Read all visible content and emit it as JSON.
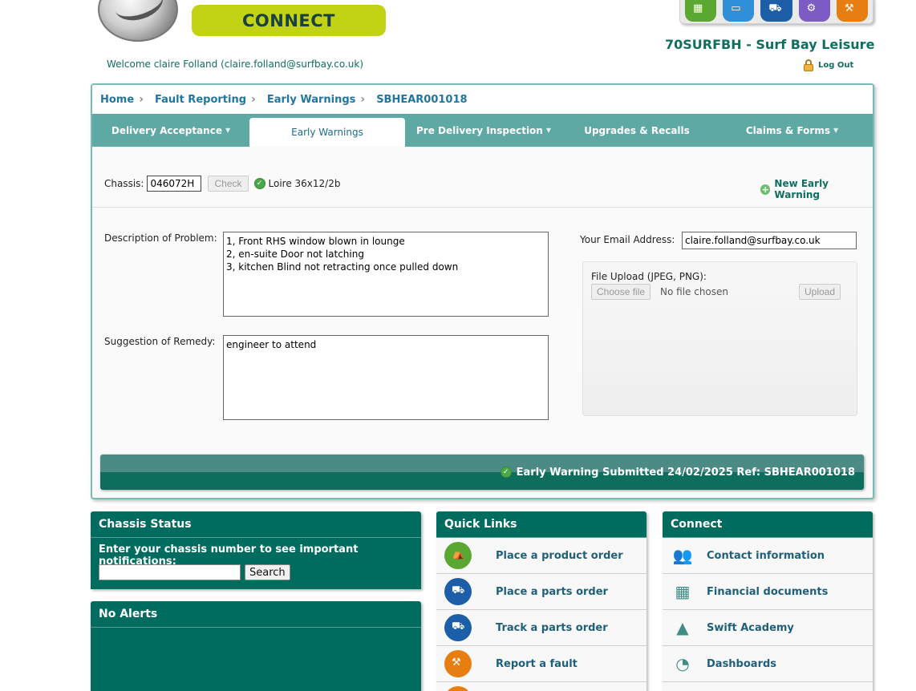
{
  "header": {
    "connect_label": "CONNECT",
    "company": "70SURFBH - Surf Bay Leisure",
    "welcome": "Welcome claire Folland (claire.folland@surfbay.co.uk)",
    "logout": "Log Out"
  },
  "breadcrumb": [
    {
      "label": "Home"
    },
    {
      "label": "Fault Reporting"
    },
    {
      "label": "Early Warnings"
    },
    {
      "label": "SBHEAR001018"
    }
  ],
  "tabs": [
    {
      "label": "Delivery Acceptance",
      "dropdown": true
    },
    {
      "label": "Early Warnings",
      "dropdown": false,
      "active": true
    },
    {
      "label": "Pre Delivery Inspection",
      "dropdown": true
    },
    {
      "label": "Upgrades & Recalls",
      "dropdown": false
    },
    {
      "label": "Claims & Forms",
      "dropdown": true
    }
  ],
  "form": {
    "chassis_label": "Chassis:",
    "chassis_value": "046072H",
    "check_button": "Check",
    "model": "Loire 36x12/2b",
    "new_early_warning": "New Early Warning",
    "description_label": "Description of Problem:",
    "description_value": "1, Front RHS window blown in lounge\n2, en-suite Door not latching\n3, kitchen Blind not retracting once pulled down",
    "remedy_label": "Suggestion of Remedy:",
    "remedy_value": "engineer to attend",
    "email_label": "Your Email Address:",
    "email_value": "claire.folland@surfbay.co.uk",
    "upload_label": "File Upload (JPEG, PNG):",
    "choose_file": "Choose file",
    "no_file": "No file chosen",
    "upload_button": "Upload"
  },
  "status": {
    "message": "Early Warning Submitted 24/02/2025 Ref: SBHEAR001018"
  },
  "chassis_status": {
    "title": "Chassis Status",
    "prompt": "Enter your chassis number to see important notifications:",
    "search_button": "Search"
  },
  "alerts": {
    "title": "No Alerts"
  },
  "quick_links": {
    "title": "Quick Links",
    "items": [
      {
        "label": "Place a product order",
        "icon": "caravan-icon",
        "color": "#5aa832"
      },
      {
        "label": "Place a parts order",
        "icon": "truck-icon",
        "color": "#1c5fa8"
      },
      {
        "label": "Track a parts order",
        "icon": "truck-icon",
        "color": "#1c5fa8"
      },
      {
        "label": "Report a fault",
        "icon": "tools-icon",
        "color": "#e67e12"
      }
    ]
  },
  "connect": {
    "title": "Connect",
    "items": [
      {
        "label": "Contact information",
        "icon": "people-icon"
      },
      {
        "label": "Financial documents",
        "icon": "calculator-icon"
      },
      {
        "label": "Swift Academy",
        "icon": "academy-icon"
      },
      {
        "label": "Dashboards",
        "icon": "gauge-icon"
      }
    ]
  }
}
